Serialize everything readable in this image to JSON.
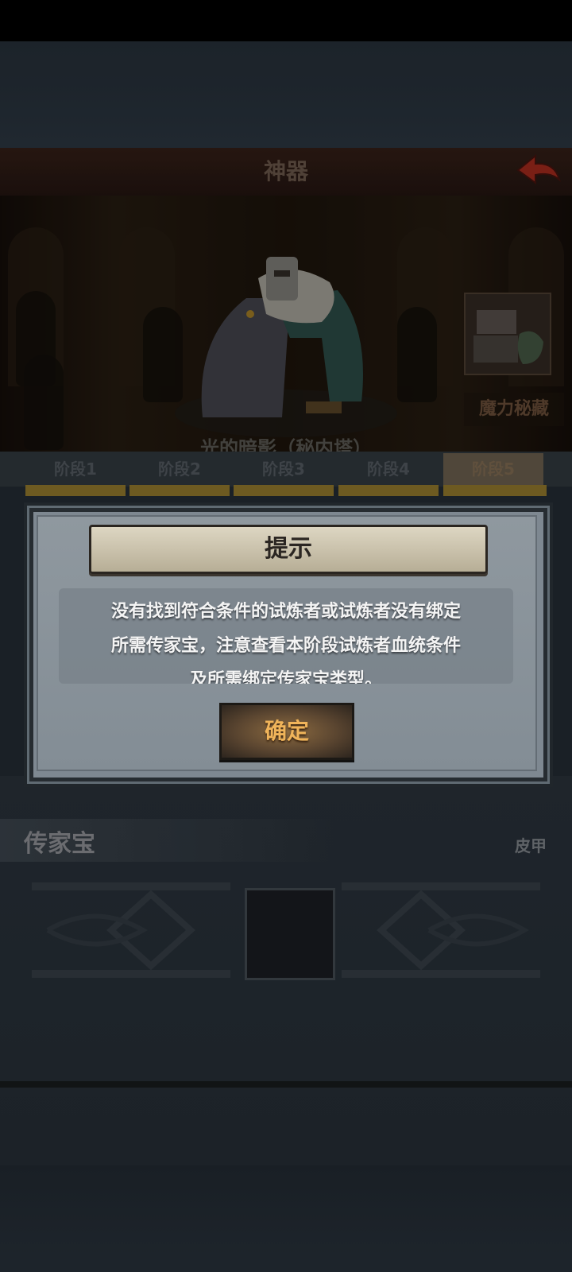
{
  "header": {
    "title": "神器"
  },
  "scene": {
    "artifact_name": "光的暗影（秘内塔）",
    "side_item_label": "魔力秘藏"
  },
  "tabs": [
    {
      "label": "阶段1",
      "active": false
    },
    {
      "label": "阶段2",
      "active": false
    },
    {
      "label": "阶段3",
      "active": false
    },
    {
      "label": "阶段4",
      "active": false
    },
    {
      "label": "阶段5",
      "active": true
    }
  ],
  "heirloom": {
    "title": "传家宝",
    "type_label": "皮甲"
  },
  "dialog": {
    "title": "提示",
    "message_lines": [
      "没有找到符合条件的试炼者或试炼者没有绑定",
      "所需传家宝，注意查看本阶段试炼者血统条件",
      "及所需绑定传家宝类型。"
    ],
    "confirm_label": "确定"
  },
  "colors": {
    "accent_gold": "#7d6726",
    "confirm_text": "#f0b45a",
    "back_arrow": "#b32a1e"
  }
}
